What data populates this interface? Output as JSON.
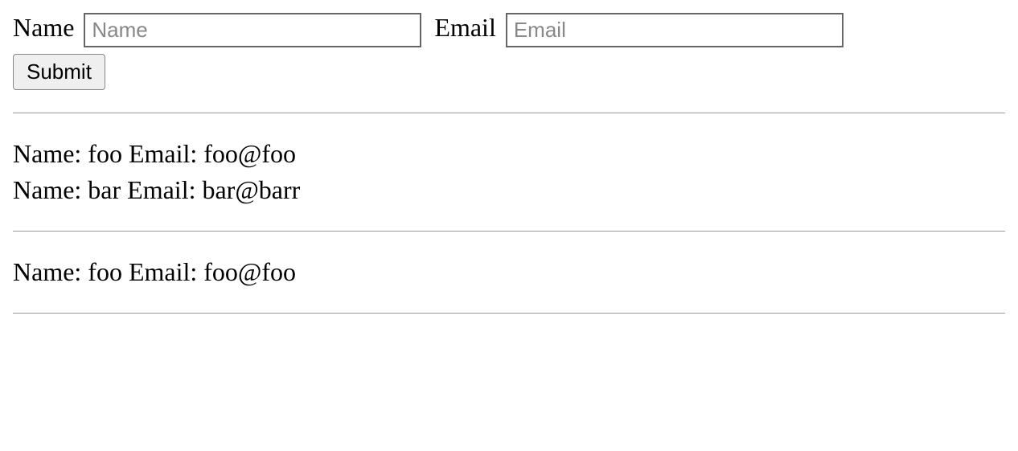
{
  "form": {
    "name_label": "Name",
    "name_placeholder": "Name",
    "name_value": "",
    "email_label": "Email",
    "email_placeholder": "Email",
    "email_value": "",
    "submit_label": "Submit"
  },
  "list1": [
    {
      "text": "Name: foo Email: foo@foo"
    },
    {
      "text": "Name: bar Email: bar@barr"
    }
  ],
  "list2": [
    {
      "text": "Name: foo Email: foo@foo"
    }
  ]
}
